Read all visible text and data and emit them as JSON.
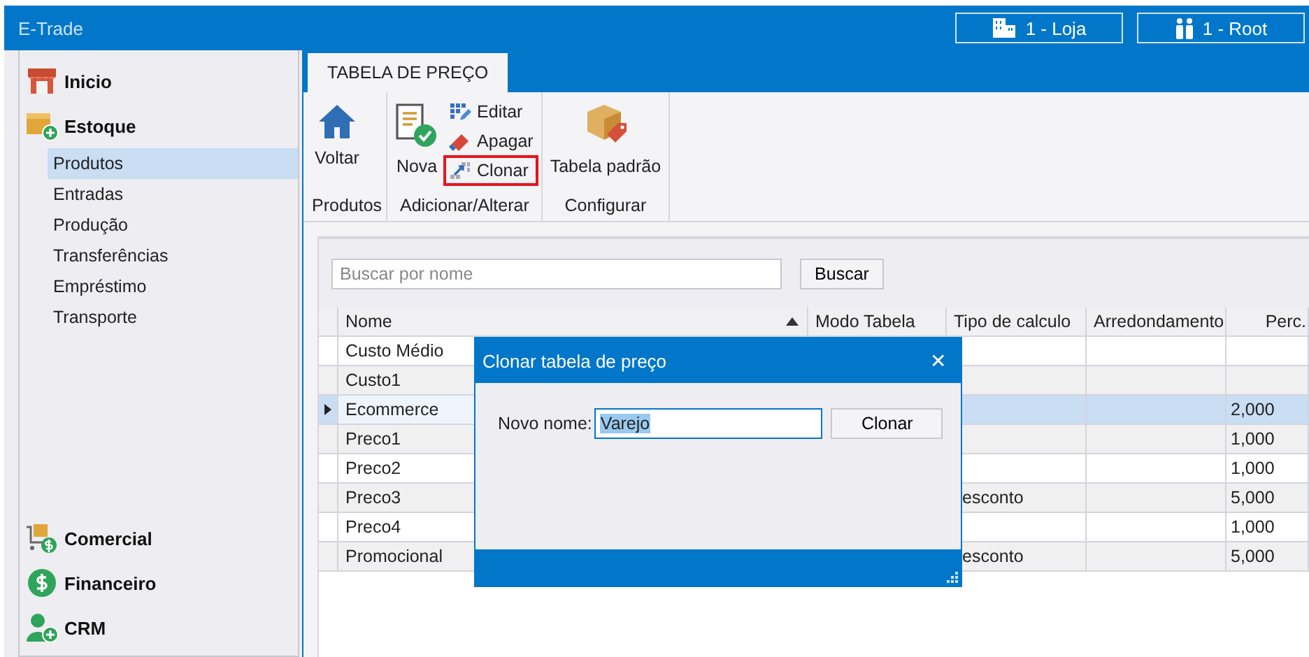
{
  "window": {
    "title": "E-Trade"
  },
  "header_buttons": [
    {
      "label": "1 - Loja"
    },
    {
      "label": "1 - Root"
    }
  ],
  "sidebar": {
    "groups": [
      {
        "label": "Inicio"
      },
      {
        "label": "Estoque",
        "children": [
          {
            "label": "Produtos",
            "selected": true
          },
          {
            "label": "Entradas",
            "selected": false
          },
          {
            "label": "Produção",
            "selected": false
          },
          {
            "label": "Transferências",
            "selected": false
          },
          {
            "label": "Empréstimo",
            "selected": false
          },
          {
            "label": "Transporte",
            "selected": false
          }
        ]
      },
      {
        "label": "Comercial"
      },
      {
        "label": "Financeiro"
      },
      {
        "label": "CRM"
      }
    ]
  },
  "tabs": [
    {
      "label": "TABELA DE PREÇO",
      "selected": true
    }
  ],
  "ribbon": {
    "groups": [
      {
        "label": "Produtos",
        "buttons": [
          {
            "kind": "large",
            "label": "Voltar",
            "highlighted": false
          }
        ]
      },
      {
        "label": "Adicionar/Alterar",
        "buttons": [
          {
            "kind": "large",
            "label": "Nova",
            "highlighted": false
          },
          {
            "kind": "small",
            "label": "Editar",
            "highlighted": false
          },
          {
            "kind": "small",
            "label": "Apagar",
            "highlighted": false
          },
          {
            "kind": "small",
            "label": "Clonar",
            "highlighted": true
          }
        ]
      },
      {
        "label": "Configurar",
        "buttons": [
          {
            "kind": "large",
            "label": "Tabela padrão",
            "highlighted": false
          }
        ]
      }
    ]
  },
  "search": {
    "placeholder": "Buscar por nome",
    "button": "Buscar"
  },
  "table": {
    "columns": [
      {
        "label": "Nome",
        "sorted": true
      },
      {
        "label": "Modo Tabela",
        "sorted": false
      },
      {
        "label": "Tipo de calculo",
        "sorted": false
      },
      {
        "label": "Arredondamento",
        "sorted": false
      },
      {
        "label": "Perc.",
        "sorted": false
      }
    ],
    "rows": [
      {
        "selected": false,
        "cells": [
          "Custo Médio",
          null,
          null,
          null,
          null
        ]
      },
      {
        "selected": false,
        "cells": [
          "Custo1",
          null,
          null,
          null,
          null
        ]
      },
      {
        "selected": true,
        "cells": [
          "Ecommerce",
          null,
          null,
          null,
          "2,000"
        ]
      },
      {
        "selected": false,
        "cells": [
          "Preco1",
          null,
          null,
          null,
          "1,000"
        ]
      },
      {
        "selected": false,
        "cells": [
          "Preco2",
          null,
          null,
          null,
          "1,000"
        ]
      },
      {
        "selected": false,
        "cells": [
          "Preco3",
          null,
          "esconto",
          null,
          "5,000"
        ]
      },
      {
        "selected": false,
        "cells": [
          "Preco4",
          null,
          null,
          null,
          "1,000"
        ]
      },
      {
        "selected": false,
        "cells": [
          "Promocional",
          null,
          "esconto",
          null,
          "5,000"
        ]
      }
    ]
  },
  "dialog": {
    "title": "Clonar tabela de preço",
    "close": "✕",
    "field_label": "Novo nome:",
    "value": "Varejo",
    "value_selected": true,
    "button": "Clonar"
  }
}
